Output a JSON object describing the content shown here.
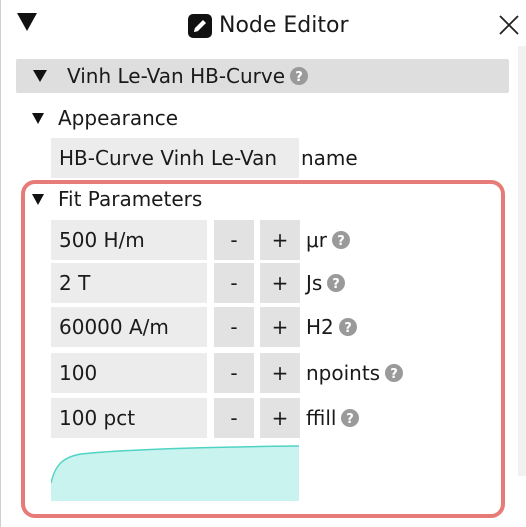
{
  "window": {
    "title": "Node Editor"
  },
  "node": {
    "title": "Vinh Le-Van HB-Curve"
  },
  "appearance": {
    "section_label": "Appearance",
    "name_value": "HB-Curve Vinh Le-Van",
    "name_label": "name"
  },
  "fit_parameters": {
    "section_label": "Fit Parameters",
    "minus_label": "-",
    "plus_label": "+",
    "params": [
      {
        "value": "500 H/m",
        "label": "μr"
      },
      {
        "value": "2 T",
        "label": "Js"
      },
      {
        "value": "60000 A/m",
        "label": "H2"
      },
      {
        "value": "100",
        "label": "npoints"
      },
      {
        "value": "100 pct",
        "label": "ffill"
      }
    ]
  },
  "colors": {
    "highlight_border": "#e77b77",
    "curve_fill": "#c9f3ef",
    "curve_stroke": "#4fd3c4",
    "node_header_bg": "#dedede"
  },
  "icons": {
    "collapse": "triangle-down-icon",
    "title": "pencil-square-icon",
    "close": "close-x-icon",
    "help": "question-circle-icon"
  }
}
